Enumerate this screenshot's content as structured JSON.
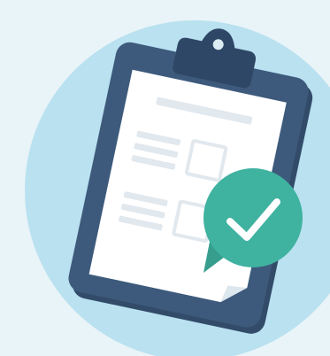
{
  "illustration": {
    "subject": "clipboard-with-checklist",
    "icons": [
      "clipboard-icon",
      "checkmark-icon"
    ]
  },
  "colors": {
    "page_background": "#e9f4f8",
    "circle": "#b9e1f0",
    "clipboard_board": "#3d5a7c",
    "clipboard_board_shadow": "#324b69",
    "clip": "#2f4766",
    "clip_hole": "#dcecf3",
    "paper": "#ffffff",
    "paper_fold": "#dde7ee",
    "paper_lines": "#e1e8ee",
    "badge": "#3fb2a0",
    "badge_dark": "#379e8e",
    "check": "#ffffff"
  }
}
